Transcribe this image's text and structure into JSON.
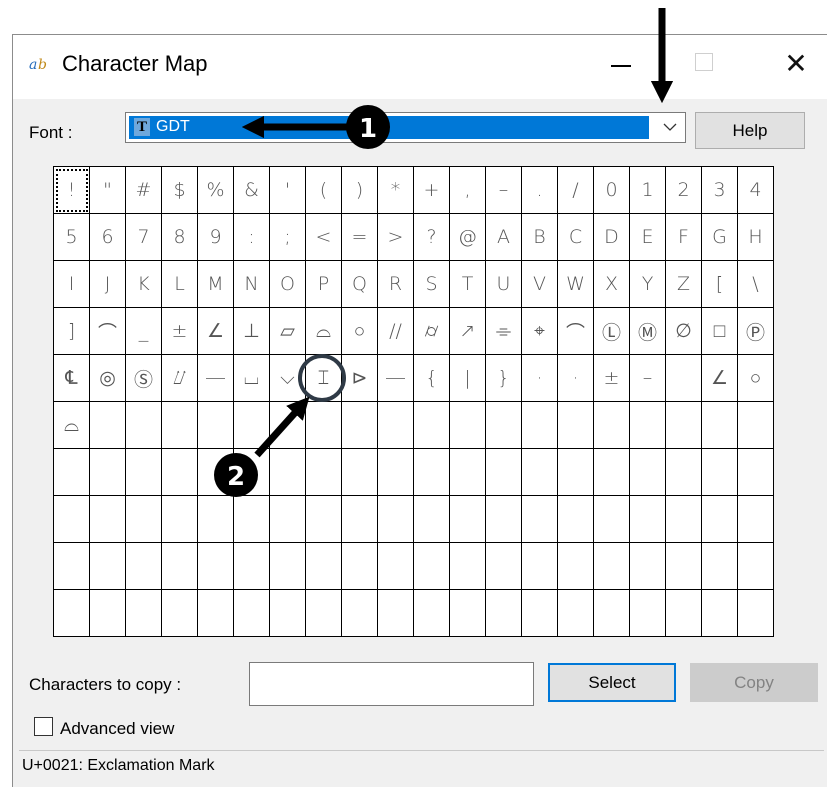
{
  "window": {
    "title": "Character Map",
    "close_glyph": "✕"
  },
  "font_row": {
    "label": "Font :",
    "selected_font": "GDT",
    "font_type_glyph": "T",
    "help_label": "Help"
  },
  "grid": {
    "selected_index": 0,
    "rows": [
      [
        "!",
        "\"",
        "#",
        "$",
        "%",
        "&",
        "'",
        "(",
        ")",
        "*",
        "+",
        ",",
        "–",
        ".",
        "/",
        "0",
        "1",
        "2",
        "3",
        "4"
      ],
      [
        "5",
        "6",
        "7",
        "8",
        "9",
        ":",
        ";",
        "<",
        "=",
        ">",
        "?",
        "@",
        "A",
        "B",
        "C",
        "D",
        "E",
        "F",
        "G",
        "H"
      ],
      [
        "I",
        "J",
        "K",
        "L",
        "M",
        "N",
        "O",
        "P",
        "Q",
        "R",
        "S",
        "T",
        "U",
        "V",
        "W",
        "X",
        "Y",
        "Z",
        "[",
        "\\"
      ],
      [
        "]",
        "⌒",
        "_",
        "±",
        "∠",
        "⊥",
        "⏥",
        "⌓",
        "○",
        "//",
        "⌭",
        "↗",
        "⌯",
        "⌖",
        "⌒",
        "Ⓛ",
        "Ⓜ",
        "∅",
        "□",
        "Ⓟ"
      ],
      [
        "℄",
        "◎",
        "Ⓢ",
        "⌰",
        "―",
        "⌴",
        "⌵",
        "⌶",
        "⊳",
        "―",
        "{",
        "|",
        "}",
        "·",
        "·",
        "±",
        "–",
        "",
        "∠",
        "○"
      ],
      [
        "⌓",
        "",
        "",
        "",
        "",
        "",
        "",
        "",
        "",
        "",
        "",
        "",
        "",
        "",
        "",
        "",
        "",
        "",
        "",
        ""
      ],
      [
        "",
        "",
        "",
        "",
        "",
        "",
        "",
        "",
        "",
        "",
        "",
        "",
        "",
        "",
        "",
        "",
        "",
        "",
        "",
        ""
      ],
      [
        "",
        "",
        "",
        "",
        "",
        "",
        "",
        "",
        "",
        "",
        "",
        "",
        "",
        "",
        "",
        "",
        "",
        "",
        "",
        ""
      ],
      [
        "",
        "",
        "",
        "",
        "",
        "",
        "",
        "",
        "",
        "",
        "",
        "",
        "",
        "",
        "",
        "",
        "",
        "",
        "",
        ""
      ],
      [
        "",
        "",
        "",
        "",
        "",
        "",
        "",
        "",
        "",
        "",
        "",
        "",
        "",
        "",
        "",
        "",
        "",
        "",
        "",
        ""
      ]
    ]
  },
  "copy_row": {
    "label": "Characters to copy :",
    "value": "",
    "select_label": "Select",
    "copy_label": "Copy"
  },
  "advanced": {
    "label": "Advanced view",
    "checked": false
  },
  "status": {
    "text": "U+0021: Exclamation Mark"
  },
  "annotations": {
    "callout_1": "1",
    "callout_2": "2"
  },
  "colors": {
    "accent": "#0078d7",
    "annotation": "#000000"
  }
}
